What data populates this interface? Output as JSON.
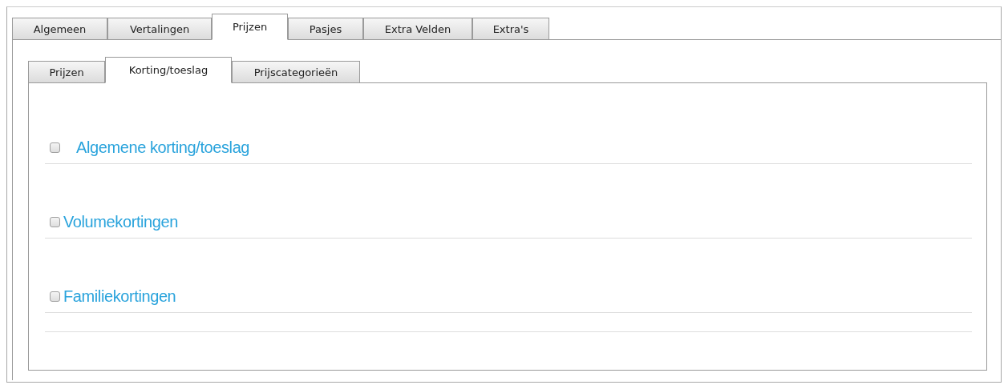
{
  "tabs": [
    {
      "label": "Algemeen",
      "selected": false
    },
    {
      "label": "Vertalingen",
      "selected": false
    },
    {
      "label": "Prijzen",
      "selected": true
    },
    {
      "label": "Pasjes",
      "selected": false
    },
    {
      "label": "Extra Velden",
      "selected": false
    },
    {
      "label": "Extra's",
      "selected": false
    }
  ],
  "subtabs": [
    {
      "label": "Prijzen",
      "selected": false
    },
    {
      "label": "Korting/toeslag",
      "selected": true
    },
    {
      "label": "Prijscategorieën",
      "selected": false
    }
  ],
  "sections": [
    {
      "label": "Algemene korting/toeslag",
      "checked": false
    },
    {
      "label": "Volumekortingen",
      "checked": false
    },
    {
      "label": "Familiekortingen",
      "checked": false
    }
  ]
}
